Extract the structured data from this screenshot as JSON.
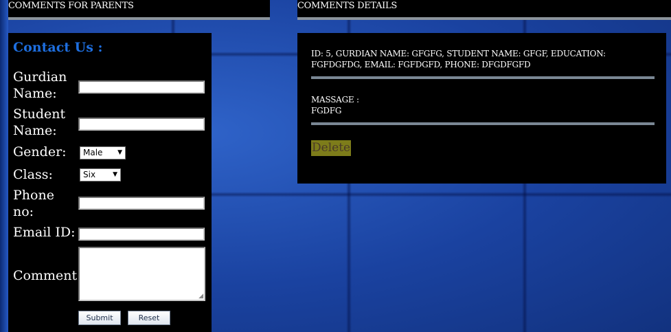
{
  "headers": {
    "left": "COMMENTS FOR PARENTS",
    "right": "COMMENTS DETAILS"
  },
  "contact_form": {
    "title": "Contact Us :",
    "guardian_label_line1": "Gurdian",
    "guardian_label_line2": "Name:",
    "guardian_value": "",
    "student_label_line1": "Student",
    "student_label_line2": "Name:",
    "student_value": "",
    "gender_label": "Gender:",
    "gender_selected": "Male",
    "class_label": "Class:",
    "class_selected": "Six",
    "phone_label_line1": "Phone",
    "phone_label_line2": "no:",
    "phone_value": "",
    "email_label": "Email ID:",
    "email_value": "",
    "comment_label": "Comment",
    "comment_value": "",
    "submit_label": "Submit",
    "reset_label": "Reset"
  },
  "comment_details": {
    "info_text": "ID: 5, GURDIAN NAME: GFGFG, STUDENT NAME: GFGF, EDUCATION: FGFDGFDG, EMAIL: FGFDGFD, PHONE: DFGDFGFD",
    "message_label": "MASSAGE :",
    "message_value": "FGDFG",
    "delete_label": "Delete"
  },
  "colors": {
    "panel_bg": "#000000",
    "title_blue": "#1e6fe0",
    "divider_gray": "#7a8794",
    "delete_bg": "#7d7c1a",
    "delete_text": "#4a3a28",
    "page_bg_blue": "#1d47a8"
  }
}
